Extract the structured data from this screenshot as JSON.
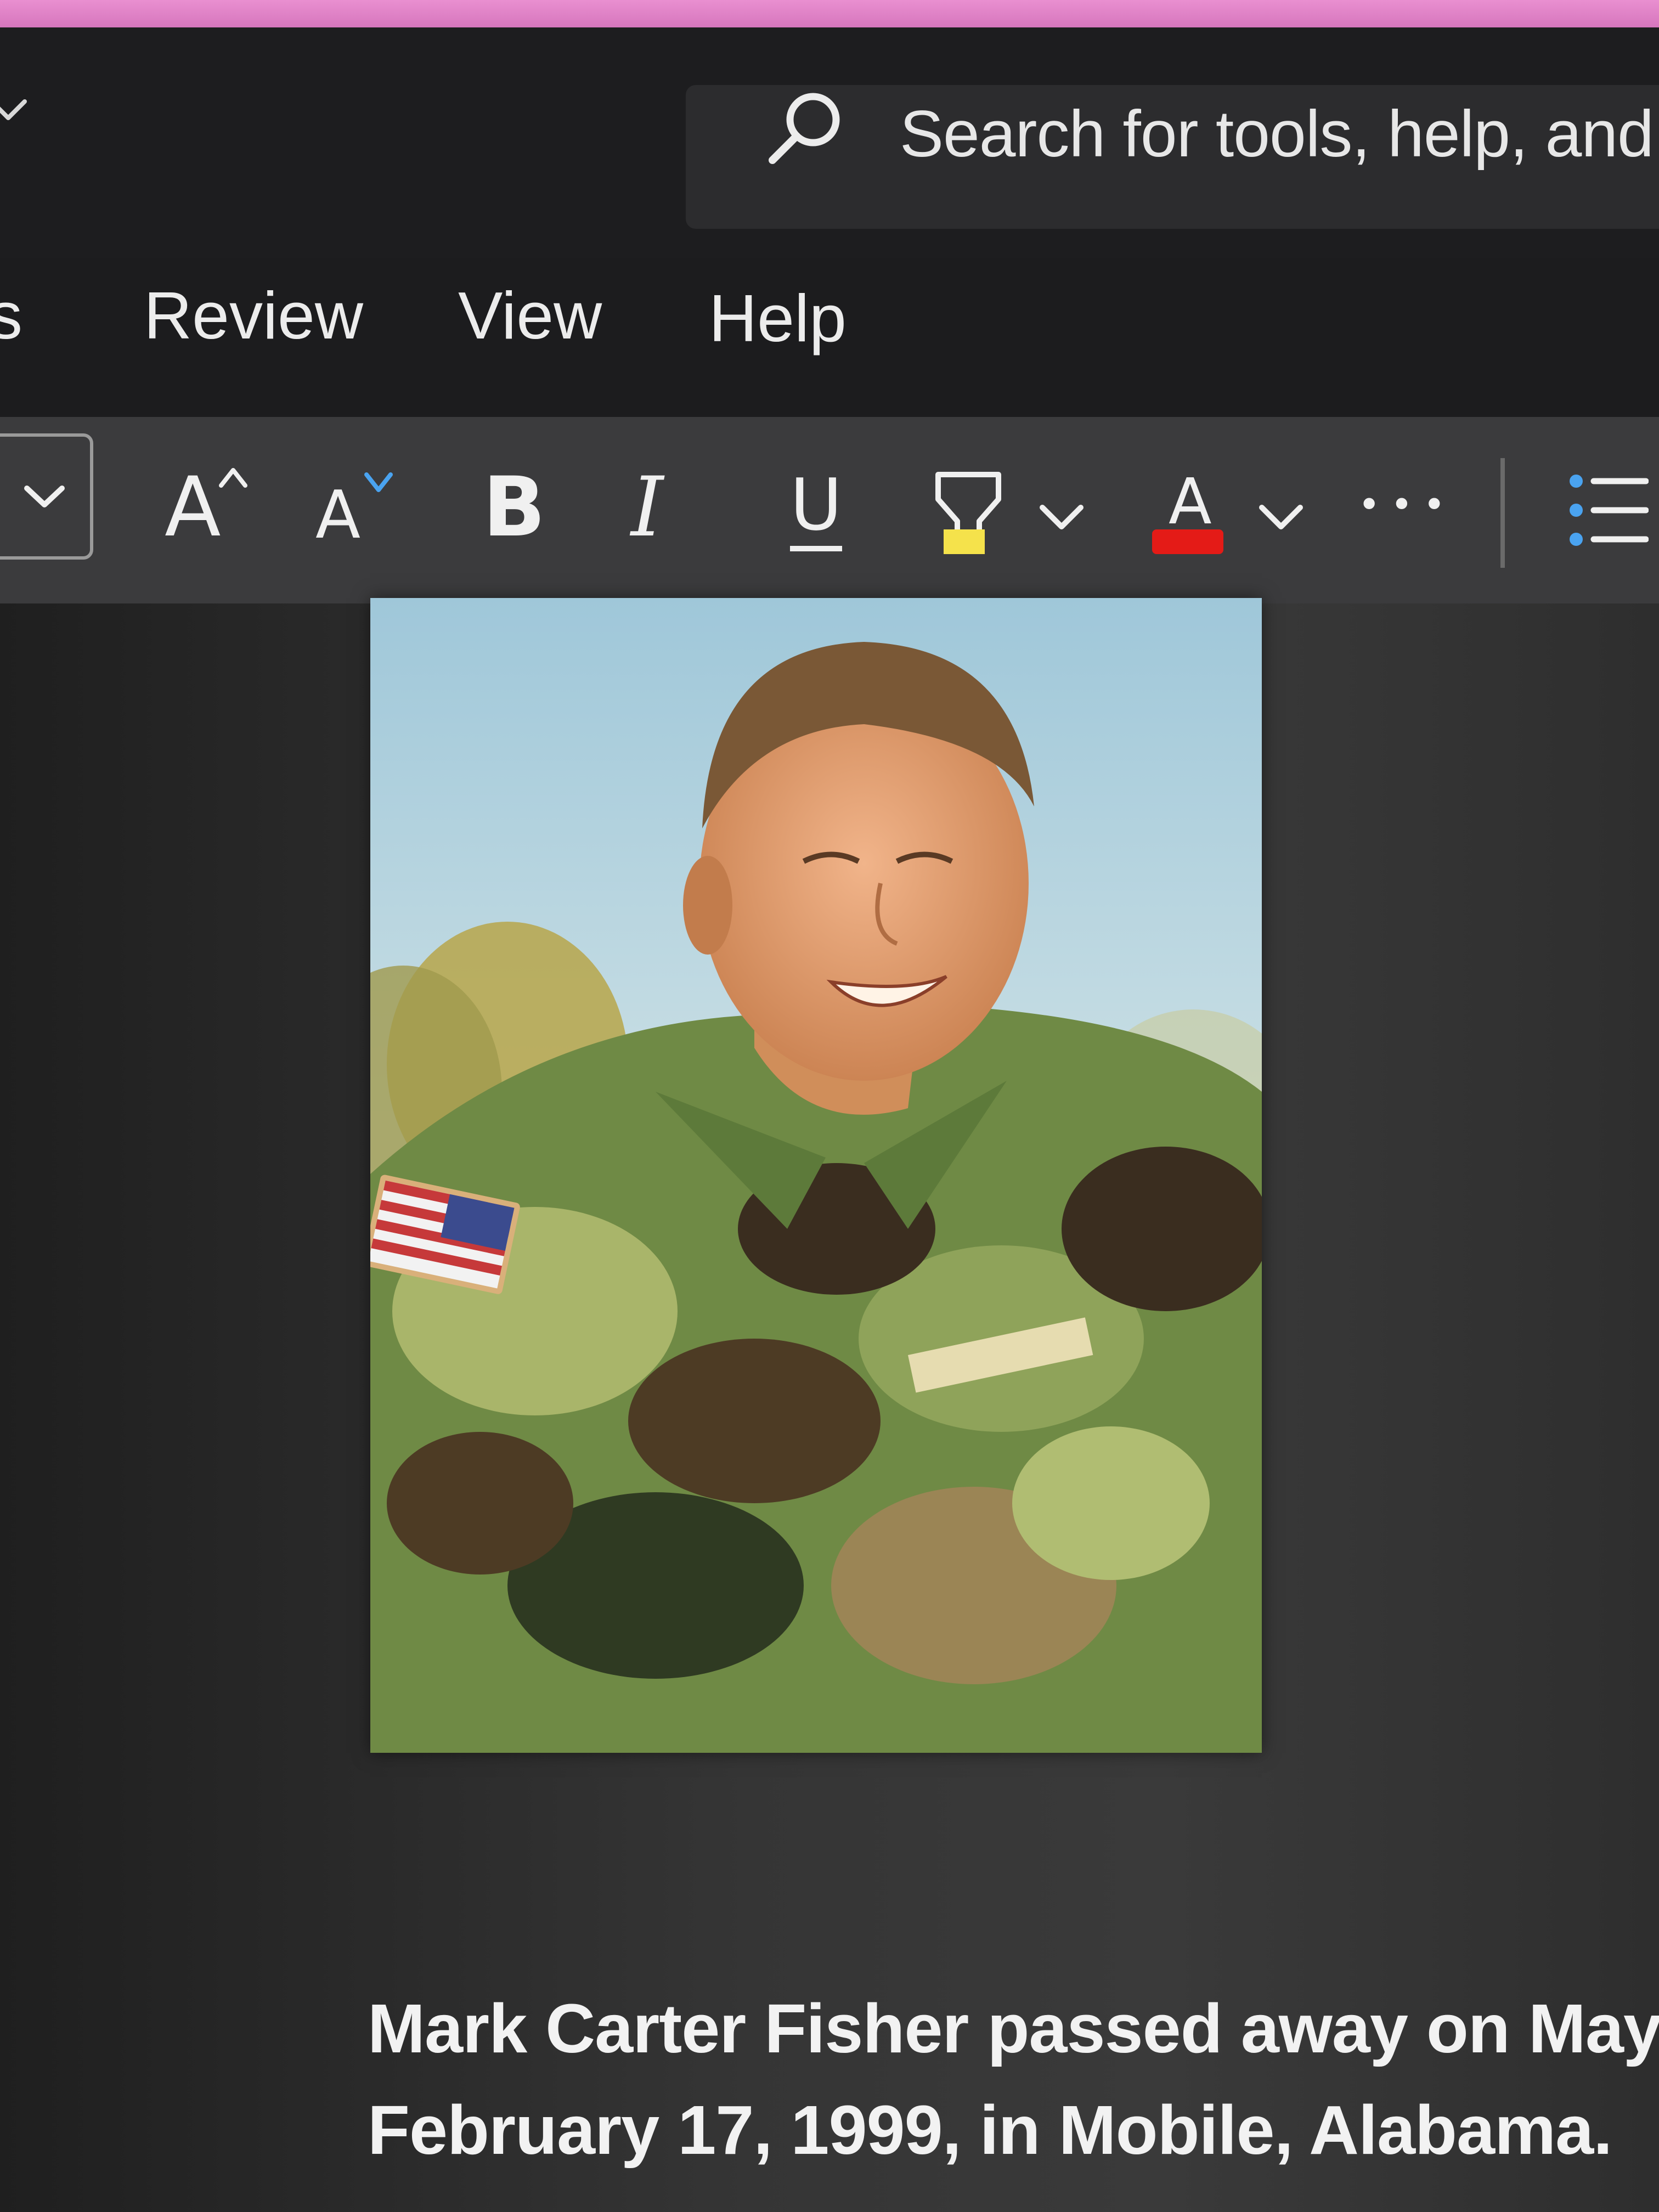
{
  "search": {
    "placeholder": "Search for tools, help, and"
  },
  "tabs": [
    {
      "label": "s"
    },
    {
      "label": "Review"
    },
    {
      "label": "View"
    },
    {
      "label": "Help"
    }
  ],
  "toolbar": {
    "grow_font_label": "A",
    "shrink_font_label": "A",
    "bold_label": "B",
    "italic_label": "I",
    "underline_label": "U",
    "font_color_label": "A",
    "more_label": "•••",
    "highlight_color": "#f5e24b",
    "font_color": "#e41b17"
  },
  "document": {
    "line1": "Mark Carter Fisher passed away on May",
    "line2": "February 17, 1999, in Mobile, Alabama."
  },
  "colors": {
    "accent_blue": "#4aa3f0",
    "bezel_pink": "#e08ad0"
  }
}
